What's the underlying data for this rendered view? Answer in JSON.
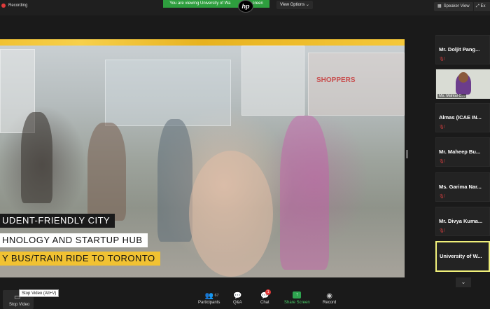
{
  "topbar": {
    "recording": "Recording",
    "viewing_banner": "You are viewing University of Wa",
    "viewing_banner_tail": "creen",
    "view_options": "View Options",
    "speaker_view": "Speaker View",
    "ex": "Ex"
  },
  "slide": {
    "store_sign": "SHOPPERS",
    "captions": [
      "UDENT-FRIENDLY CITY",
      "HNOLOGY AND STARTUP HUB",
      "Y BUS/TRAIN RIDE TO TORONTO"
    ]
  },
  "gallery": {
    "tiles": [
      {
        "name": "Mr. Doljit Pang...",
        "muted": true
      },
      {
        "name": "Ms. Mahtal C...",
        "video": true
      },
      {
        "name": "Almas  (ICAE IN...",
        "muted": true
      },
      {
        "name": "Mr. Maheep Bu...",
        "muted": true
      },
      {
        "name": "Ms. Garima Nar...",
        "muted": true
      },
      {
        "name": "Mr. Divya Kuma...",
        "muted": true
      },
      {
        "name": "University of W...",
        "active": true
      }
    ]
  },
  "toolbar": {
    "stop_video": "Stop Video",
    "tooltip": "Stop Video (Alt+V)",
    "participants": "Participants",
    "participants_count": "67",
    "qa": "Q&A",
    "chat": "Chat",
    "chat_badge": "1",
    "share_screen": "Share Screen",
    "record": "Record"
  },
  "colors": {
    "accent_green": "#2ea44f",
    "active_border": "#f0f07a",
    "slide_yellow": "#f1c232",
    "recording_red": "#e03a3a"
  }
}
